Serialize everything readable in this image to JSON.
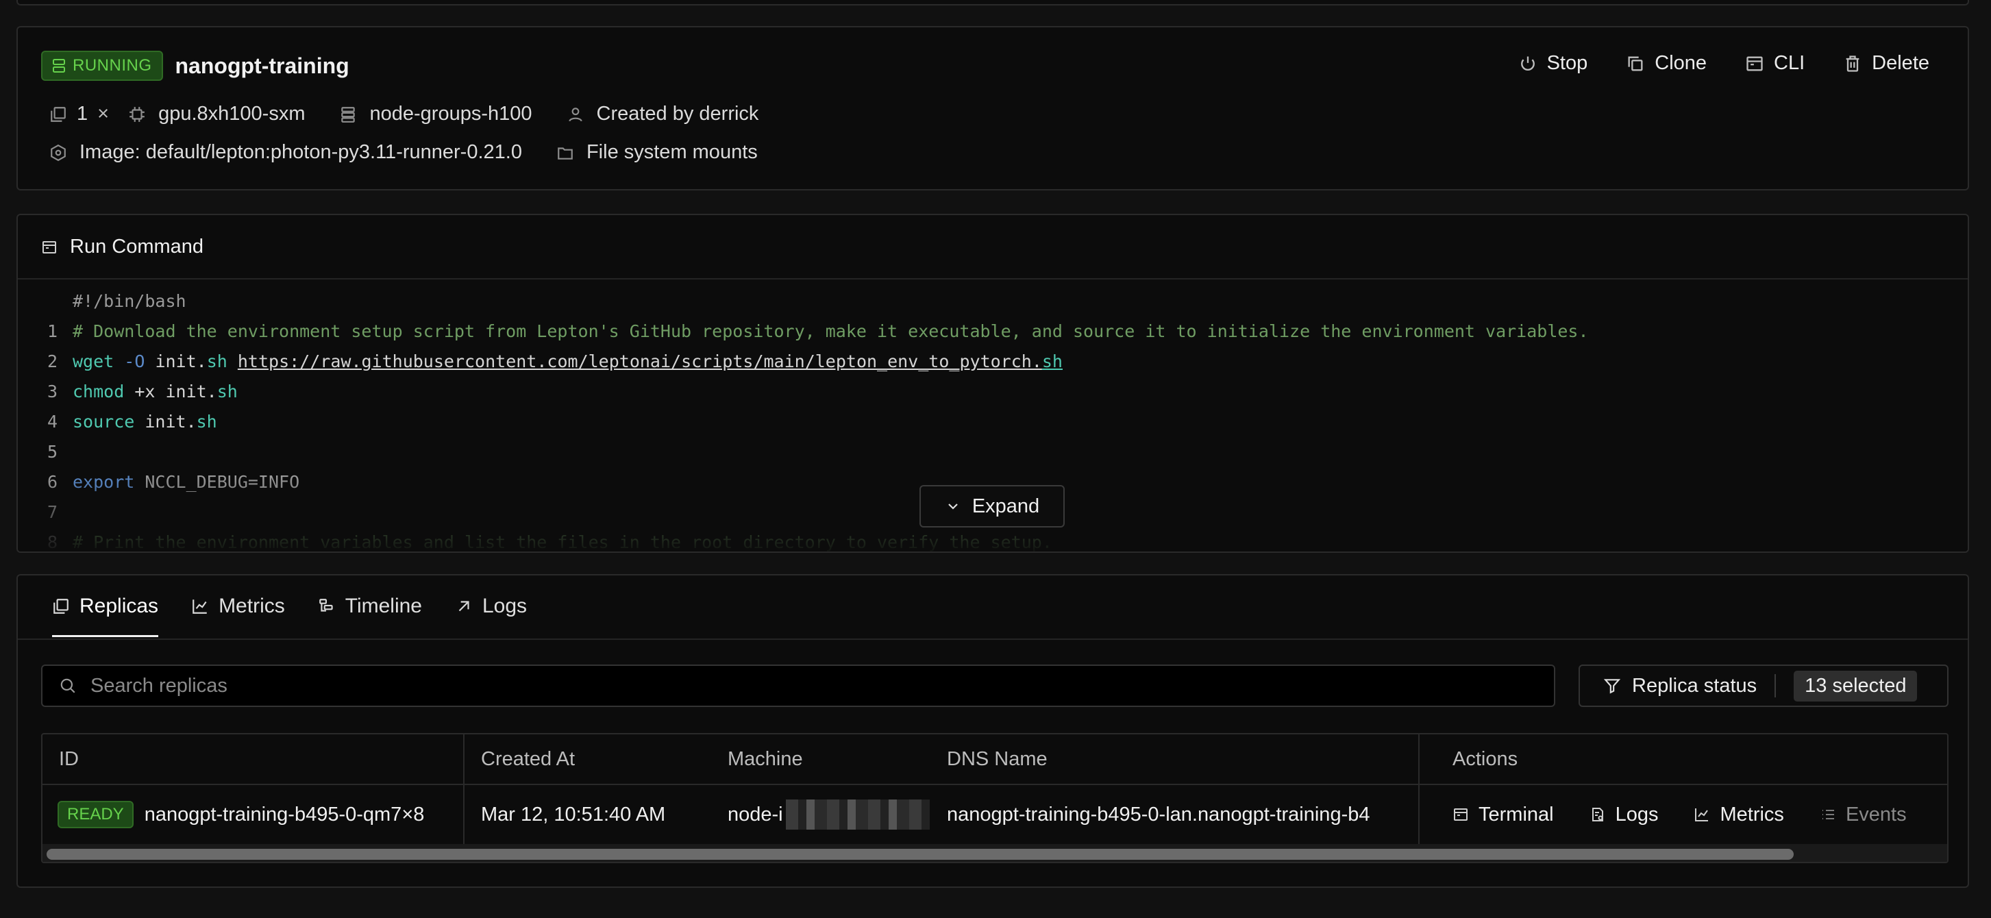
{
  "job": {
    "status": "RUNNING",
    "name": "nanogpt-training",
    "actions": {
      "stop": "Stop",
      "clone": "Clone",
      "cli": "CLI",
      "delete": "Delete"
    },
    "replica_count": "1",
    "multiply": "×",
    "resource_shape": "gpu.8xh100-sxm",
    "node_group": "node-groups-h100",
    "created_by": "Created by derrick",
    "image": "Image: default/lepton:photon-py3.11-runner-0.21.0",
    "mounts": "File system mounts"
  },
  "run_command": {
    "title": "Run Command",
    "shebang": "#!/bin/bash",
    "lines": [
      {
        "n": "1",
        "comment": "# Download the environment setup script from Lepton's GitHub repository, make it executable, and source it to initialize the environment variables."
      },
      {
        "n": "2",
        "cmd": "wget",
        "flag": " -O ",
        "file": "init.",
        "ext": "sh",
        "space": " ",
        "url": "https://raw.githubusercontent.com/leptonai/scripts/main/lepton_env_to_pytorch.",
        "url_ext": "sh"
      },
      {
        "n": "3",
        "cmd": "chmod",
        "args": " +x init.",
        "ext": "sh"
      },
      {
        "n": "4",
        "cmd": "source",
        "args": " init.",
        "ext": "sh"
      },
      {
        "n": "5"
      },
      {
        "n": "6",
        "kw": "export",
        "args": " NCCL_DEBUG=INFO"
      },
      {
        "n": "7"
      },
      {
        "n": "8",
        "comment": "# Print the environment variables and list the files in the root directory to verify the setup."
      }
    ],
    "expand_label": "Expand"
  },
  "tabs": [
    {
      "label": "Replicas",
      "active": true
    },
    {
      "label": "Metrics"
    },
    {
      "label": "Timeline"
    },
    {
      "label": "Logs"
    }
  ],
  "search": {
    "placeholder": "Search replicas"
  },
  "filter": {
    "label": "Replica status",
    "selected": "13 selected"
  },
  "table": {
    "headers": {
      "id": "ID",
      "created_at": "Created At",
      "machine": "Machine",
      "dns": "DNS Name",
      "actions": "Actions"
    },
    "rows": [
      {
        "status": "READY",
        "id": "nanogpt-training-b495-0-qm7×8",
        "created_at": "Mar 12, 10:51:40 AM",
        "machine": "node-i",
        "dns": "nanogpt-training-b495-0-lan.nanogpt-training-b4",
        "actions": {
          "terminal": "Terminal",
          "logs": "Logs",
          "metrics": "Metrics",
          "events": "Events"
        }
      }
    ]
  }
}
